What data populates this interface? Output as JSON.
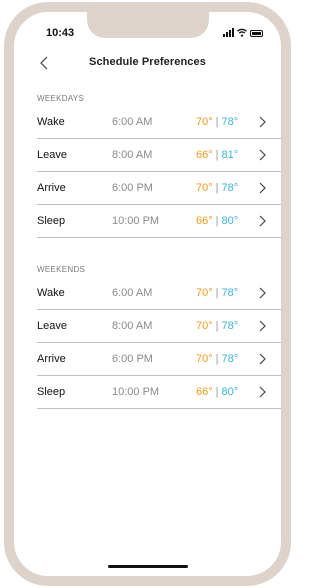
{
  "status": {
    "time": "10:43"
  },
  "nav": {
    "title": "Schedule Preferences"
  },
  "weekdays": {
    "header": "WEEKDAYS",
    "rows": [
      {
        "label": "Wake",
        "time": "6:00 AM",
        "heat": "70°",
        "sep": "|",
        "cool": "78°"
      },
      {
        "label": "Leave",
        "time": "8:00 AM",
        "heat": "66°",
        "sep": "|",
        "cool": "81°"
      },
      {
        "label": "Arrive",
        "time": "6:00 PM",
        "heat": "70°",
        "sep": "|",
        "cool": "78°"
      },
      {
        "label": "Sleep",
        "time": "10:00 PM",
        "heat": "66°",
        "sep": "|",
        "cool": "80°"
      }
    ]
  },
  "weekends": {
    "header": "WEEKENDS",
    "rows": [
      {
        "label": "Wake",
        "time": "6:00 AM",
        "heat": "70°",
        "sep": "|",
        "cool": "78°"
      },
      {
        "label": "Leave",
        "time": "8:00 AM",
        "heat": "70°",
        "sep": "|",
        "cool": "78°"
      },
      {
        "label": "Arrive",
        "time": "6:00 PM",
        "heat": "70°",
        "sep": "|",
        "cool": "78°"
      },
      {
        "label": "Sleep",
        "time": "10:00 PM",
        "heat": "66°",
        "sep": "|",
        "cool": "80°"
      }
    ]
  },
  "colors": {
    "heat": "#f29a1b",
    "cool": "#3ab4e0",
    "frame": "#ddd3ca"
  },
  "icons": {
    "back": "chevron-left-icon",
    "row": "chevron-right-icon"
  }
}
